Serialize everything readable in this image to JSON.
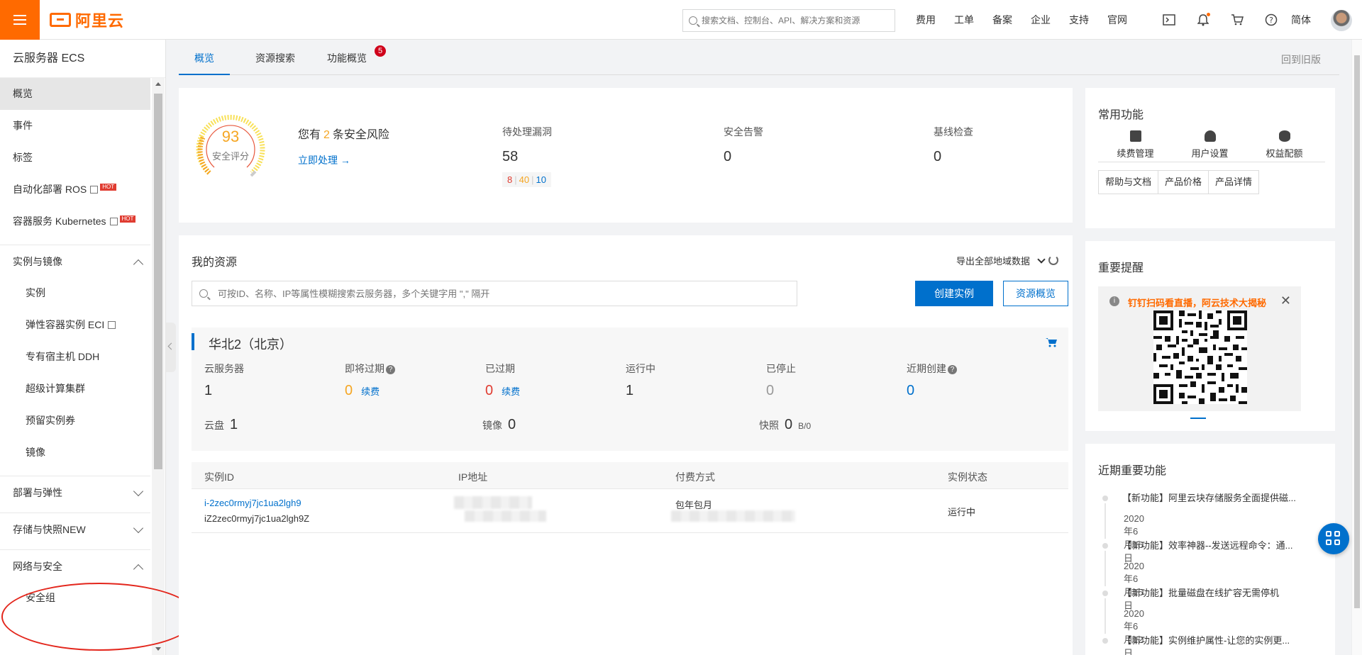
{
  "header": {
    "brand": "阿里云",
    "search_placeholder": "搜索文档、控制台、API、解决方案和资源",
    "nav": [
      "费用",
      "工单",
      "备案",
      "企业",
      "支持",
      "官网"
    ],
    "lang": "简体"
  },
  "sidebar": {
    "title": "云服务器 ECS",
    "items": [
      {
        "label": "概览"
      },
      {
        "label": "事件"
      },
      {
        "label": "标签"
      },
      {
        "label": "自动化部署 ROS",
        "badge": "HOT"
      },
      {
        "label": "容器服务 Kubernetes",
        "badge": "HOT"
      }
    ],
    "groups": [
      {
        "label": "实例与镜像",
        "items": [
          "实例",
          "弹性容器实例 ECI",
          "专有宿主机 DDH",
          "超级计算集群",
          "预留实例券",
          "镜像"
        ]
      },
      {
        "label": "部署与弹性"
      },
      {
        "label": "存储与快照",
        "badge": "NEW"
      },
      {
        "label": "网络与安全",
        "items": [
          "安全组"
        ]
      }
    ]
  },
  "tabs": [
    {
      "label": "概览"
    },
    {
      "label": "资源搜索"
    },
    {
      "label": "功能概览",
      "badge": "5"
    }
  ],
  "back_old": "回到旧版",
  "security": {
    "score": "93",
    "score_label": "安全评分",
    "prefix": "您有",
    "risk_count": "2",
    "suffix": "条安全风险",
    "action": "立即处理 →",
    "stats": [
      {
        "label": "待处理漏洞",
        "value": "58"
      },
      {
        "label": "安全告警",
        "value": "0"
      },
      {
        "label": "基线检查",
        "value": "0"
      }
    ],
    "vuln_high": "8",
    "vuln_mid": "40",
    "vuln_low": "10"
  },
  "resources": {
    "title": "我的资源",
    "export": "导出全部地域数据",
    "search_placeholder": "可按ID、名称、IP等属性模糊搜索云服务器，多个关键字用 \",\" 隔开",
    "create_btn": "创建实例",
    "overview_btn": "资源概览",
    "region": {
      "name": "华北2（北京）",
      "metrics": [
        {
          "label": "云服务器",
          "value": "1"
        },
        {
          "label": "即将过期",
          "value": "0",
          "renew": "续费"
        },
        {
          "label": "已过期",
          "value": "0",
          "renew": "续费"
        },
        {
          "label": "运行中",
          "value": "1"
        },
        {
          "label": "已停止",
          "value": "0"
        },
        {
          "label": "近期创建",
          "value": "0"
        }
      ],
      "disk_label": "云盘",
      "disk_value": "1",
      "image_label": "镜像",
      "image_value": "0",
      "snapshot_label": "快照",
      "snapshot_value": "0",
      "snapshot_unit": "B/0"
    },
    "table": {
      "headers": [
        "实例ID",
        "IP地址",
        "付费方式",
        "实例状态"
      ],
      "rows": [
        {
          "id": "i-2zec0rmyj7jc1ua2lgh9",
          "name": "iZ2zec0rmyj7jc1ua2lgh9Z",
          "billing": "包年包月",
          "status": "运行中"
        }
      ]
    }
  },
  "quick": {
    "title": "常用功能",
    "items": [
      "续费管理",
      "用户设置",
      "权益配额"
    ],
    "buttons": [
      "帮助与文档",
      "产品价格",
      "产品详情"
    ]
  },
  "notice": {
    "title": "重要提醒",
    "text": "钉钉扫码看直播，阿云技术大揭秘",
    "close": "✕"
  },
  "features": {
    "title": "近期重要功能",
    "items": [
      {
        "title": "【新功能】阿里云块存储服务全面提供磁...",
        "date": "2020年6月16日"
      },
      {
        "title": "【新功能】效率神器--发送远程命令：通...",
        "date": "2020年6月15日"
      },
      {
        "title": "【新功能】批量磁盘在线扩容无需停机",
        "date": "2020年6月12日"
      },
      {
        "title": "【新功能】实例维护属性-让您的实例更...",
        "date": ""
      }
    ]
  },
  "colors": {
    "brand": "#ff6a00",
    "primary": "#0070cc",
    "danger": "#e03c31",
    "warning": "#f5a623",
    "annotation": "#e3261c"
  }
}
